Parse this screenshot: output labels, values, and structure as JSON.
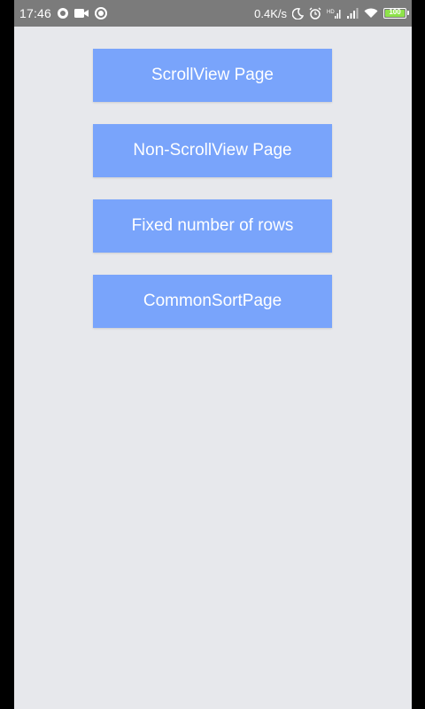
{
  "status_bar": {
    "time": "17:46",
    "left_icons": [
      "circle-notification-icon",
      "video-camera-icon",
      "record-circle-icon"
    ],
    "network_speed": "0.4K/s",
    "right_icons": [
      "do-not-disturb-icon",
      "alarm-clock-icon",
      "cellular-signal-1-icon",
      "cellular-signal-2-icon",
      "wifi-icon",
      "battery-icon"
    ],
    "battery_level": "100",
    "battery_color": "#8ee24a"
  },
  "main": {
    "background": "#e7e8ec",
    "button_color": "#79a4fb",
    "buttons": [
      {
        "label": "ScrollView Page"
      },
      {
        "label": "Non-ScrollView Page"
      },
      {
        "label": "Fixed number of rows"
      },
      {
        "label": "CommonSortPage"
      }
    ]
  }
}
